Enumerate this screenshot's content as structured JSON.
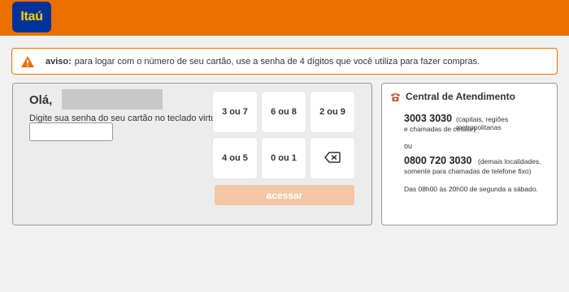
{
  "header": {
    "logo_text": "Itaú",
    "brand_color": "#ec7000",
    "logo_color": "#003399"
  },
  "alert": {
    "icon": "warning-icon",
    "label": "aviso:",
    "message": "para logar com o número de seu cartão, use a senha de 4 dígitos que você utiliza para fazer compras."
  },
  "login": {
    "greeting": "Olá,",
    "instruction": "Digite sua senha do seu cartão no teclado virtual:",
    "password_value": "",
    "keys": [
      "3 ou 7",
      "6 ou 8",
      "2 ou 9",
      "4 ou 5",
      "0 ou 1"
    ],
    "backspace_icon": "backspace-icon",
    "submit_label": "acessar"
  },
  "help": {
    "icon": "phone-icon",
    "title": "Central de Atendimento",
    "phone1": "3003 3030",
    "phone1_desc_a": "(capitais, regiões metropolitanas",
    "phone1_desc_b": "e chamadas de celular)",
    "or": "ou",
    "phone2": "0800 720 3030",
    "phone2_desc_a": "(demais localidades,",
    "phone2_desc_b": "somente para chamadas de telefone fixo)",
    "hours": "Das 08h00 às 20h00 de segunda a sábado."
  }
}
